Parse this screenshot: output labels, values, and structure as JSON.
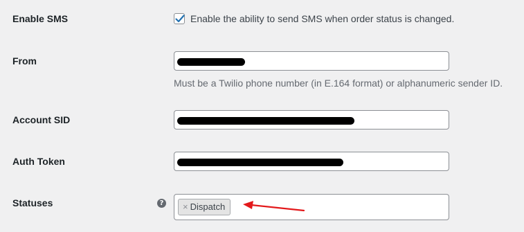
{
  "fields": {
    "enable_sms": {
      "label": "Enable SMS",
      "checked": true,
      "checkbox_text": "Enable the ability to send SMS when order status is changed."
    },
    "from": {
      "label": "From",
      "value": "[redacted]",
      "description": "Must be a Twilio phone number (in E.164 format) or alphanumeric sender ID."
    },
    "account_sid": {
      "label": "Account SID",
      "value": "[redacted]"
    },
    "auth_token": {
      "label": "Auth Token",
      "value": "[redacted]"
    },
    "statuses": {
      "label": "Statuses",
      "help_icon": "question-circle-icon",
      "help_glyph": "?",
      "remove_glyph": "×",
      "selected": [
        "Dispatch"
      ]
    }
  },
  "colors": {
    "background": "#f0f0f1",
    "checkbox_accent": "#2271b1",
    "annotation_arrow": "#e3191b",
    "redaction": "#000000"
  }
}
